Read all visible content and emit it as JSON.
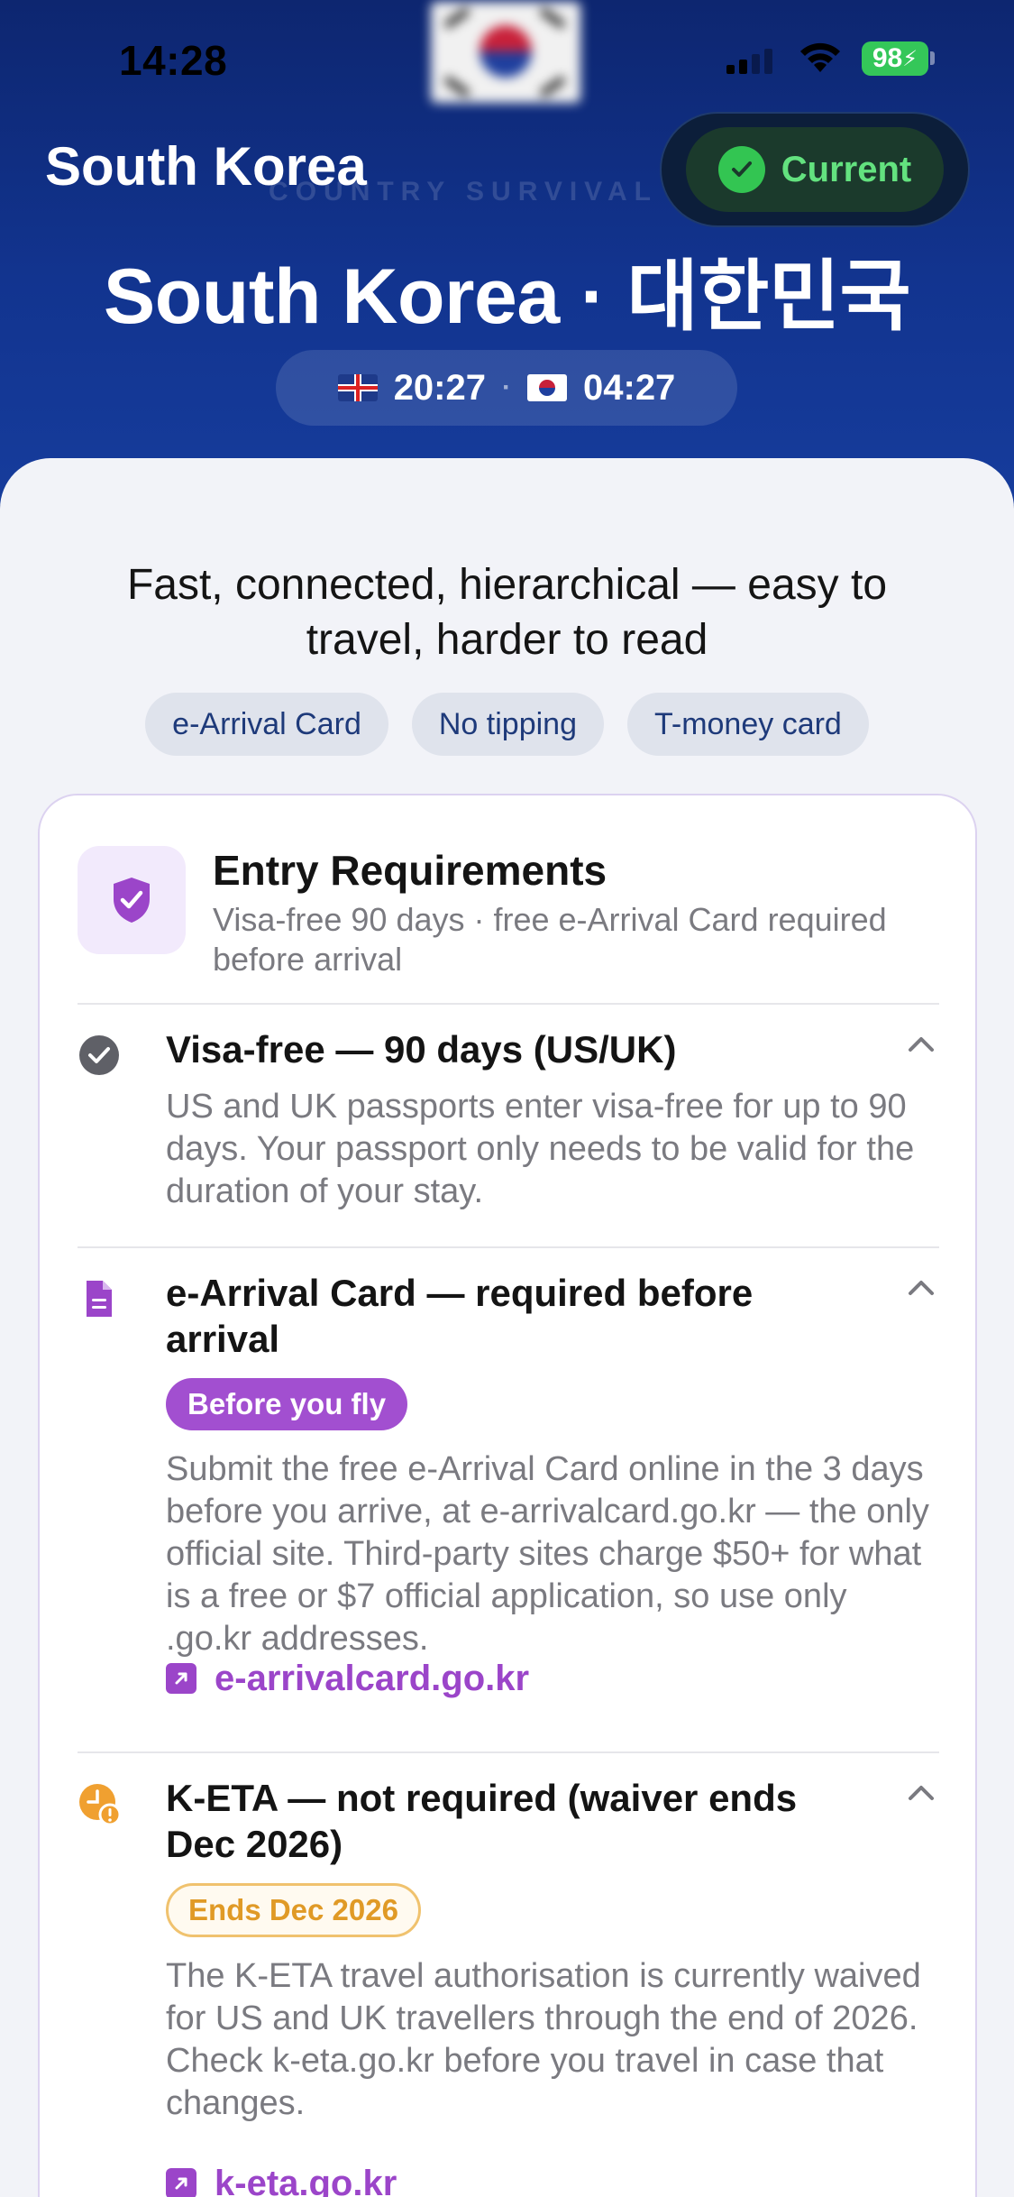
{
  "status_bar": {
    "time": "14:28",
    "battery": "98"
  },
  "header": {
    "title": "South Korea",
    "subtitle_label": "COUNTRY SURVIVAL",
    "current_label": "Current",
    "country_full": "South Korea · 대한민국",
    "home_time": "20:27",
    "separator": "·",
    "local_time": "04:27"
  },
  "overview": {
    "tagline": "Fast, connected, hierarchical — easy to travel, harder to read",
    "chips": [
      "e-Arrival Card",
      "No tipping",
      "T-money card"
    ]
  },
  "entry_card": {
    "title": "Entry Requirements",
    "subtitle": "Visa-free 90 days · free e-Arrival Card required before arrival",
    "items": [
      {
        "icon": "check-circle-icon",
        "title": "Visa-free — 90 days (US/UK)",
        "body": "US and UK passports enter visa-free for up to 90 days. Your passport only needs to be valid for the duration of your stay."
      },
      {
        "icon": "document-icon",
        "title": "e-Arrival Card — required before arrival",
        "badge": "Before you fly",
        "body": "Submit the free e-Arrival Card online in the 3 days before you arrive, at e-arrivalcard.go.kr — the only official site. Third-party sites charge $50+ for what is a free or $7 official application, so use only .go.kr addresses.",
        "link": "e-arrivalcard.go.kr"
      },
      {
        "icon": "clock-alert-icon",
        "title": "K-ETA — not required (waiver ends Dec 2026)",
        "badge": "Ends Dec 2026",
        "body": "The K-ETA travel authorisation is currently waived for US and UK travellers through the end of 2026. Check k-eta.go.kr before you travel in case that changes.",
        "link": "k-eta.go.kr"
      }
    ]
  },
  "colors": {
    "hero": "#12348f",
    "accent_purple": "#9b45c9",
    "current_green": "#63e27f",
    "warning_orange": "#f0a030"
  }
}
